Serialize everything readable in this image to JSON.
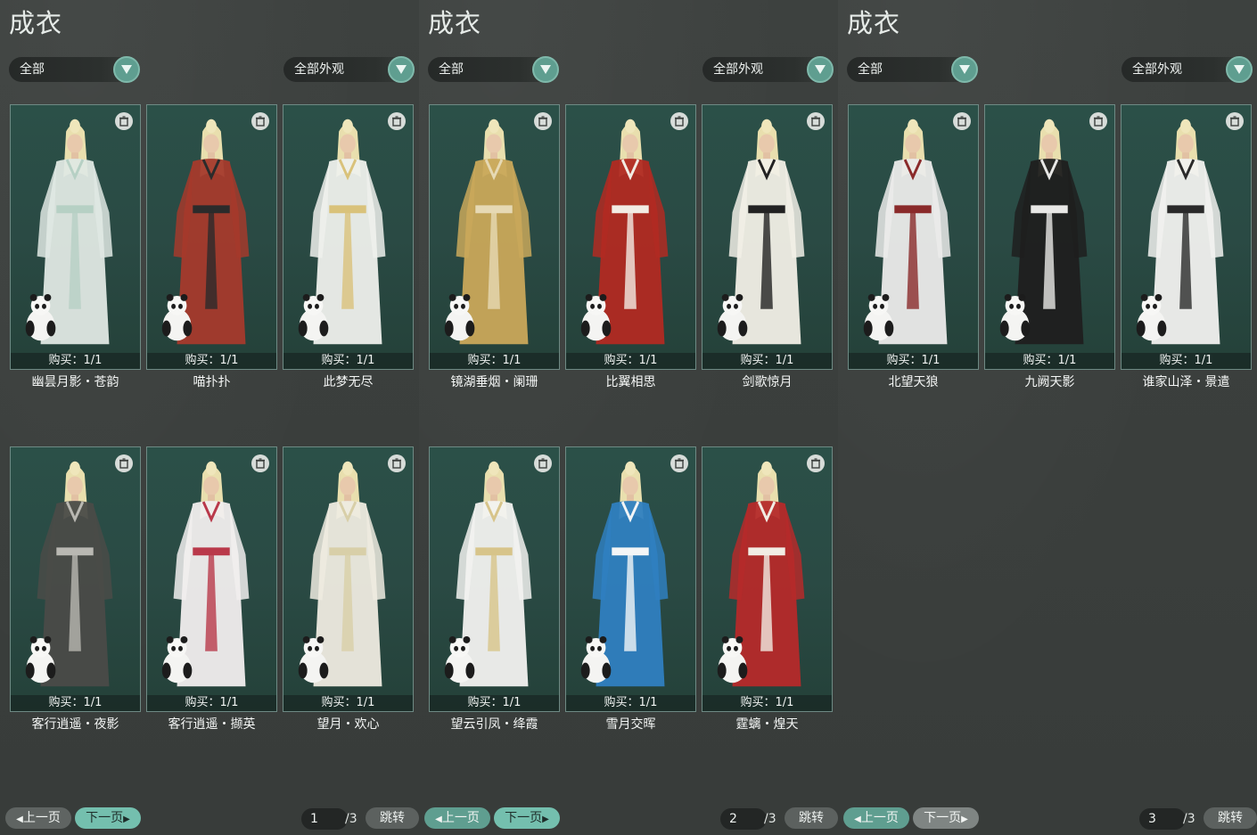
{
  "panels": [
    {
      "title": "成衣",
      "filter_left": "全部",
      "filter_right": "全部外观",
      "cards": [
        {
          "name": "幽昙月影・苍韵",
          "buy": "购买：1/1",
          "outfit_color": "#dfe8e3",
          "accent": "#b6d0c4"
        },
        {
          "name": "喵扑扑",
          "buy": "购买：1/1",
          "outfit_color": "#a53a2c",
          "accent": "#2b2b2b"
        },
        {
          "name": "此梦无尽",
          "buy": "购买：1/1",
          "outfit_color": "#eef0ec",
          "accent": "#d9c27a"
        },
        {
          "name": "客行逍遥・夜影",
          "buy": "购买：1/1",
          "outfit_color": "#4a4b48",
          "accent": "#b9b8b2"
        },
        {
          "name": "客行逍遥・撷英",
          "buy": "购买：1/1",
          "outfit_color": "#f1eeee",
          "accent": "#b9394a"
        },
        {
          "name": "望月・欢心",
          "buy": "购买：1/1",
          "outfit_color": "#eeebe0",
          "accent": "#d8cfa8"
        }
      ],
      "prev_label": "上一页",
      "next_label": "下一页",
      "page_current": "1",
      "page_total": "/3",
      "jump_label": "跳转"
    },
    {
      "title": "成衣",
      "filter_left": "全部",
      "filter_right": "全部外观",
      "cards": [
        {
          "name": "镜湖垂烟・阑珊",
          "buy": "购买：1/1",
          "outfit_color": "#c9a85a",
          "accent": "#e6d9b4"
        },
        {
          "name": "比翼相思",
          "buy": "购买：1/1",
          "outfit_color": "#b12a22",
          "accent": "#f2ece4"
        },
        {
          "name": "剑歌惊月",
          "buy": "购买：1/1",
          "outfit_color": "#f1efe6",
          "accent": "#222222"
        },
        {
          "name": "望云引凤・绛霞",
          "buy": "购买：1/1",
          "outfit_color": "#f2f2f0",
          "accent": "#d7c48a"
        },
        {
          "name": "雪月交晖",
          "buy": "购买：1/1",
          "outfit_color": "#2f7fc0",
          "accent": "#f3f5f6"
        },
        {
          "name": "霆螭・煌天",
          "buy": "购买：1/1",
          "outfit_color": "#b52a2a",
          "accent": "#f1ece4"
        }
      ],
      "prev_label": "上一页",
      "next_label": "下一页",
      "page_current": "2",
      "page_total": "/3",
      "jump_label": "跳转"
    },
    {
      "title": "成衣",
      "filter_left": "全部",
      "filter_right": "全部外观",
      "cards": [
        {
          "name": "北望天狼",
          "buy": "购买：1/1",
          "outfit_color": "#ebebea",
          "accent": "#8a2a2a"
        },
        {
          "name": "九阙天影",
          "buy": "购买：1/1",
          "outfit_color": "#1f1f1f",
          "accent": "#e8e8e6"
        },
        {
          "name": "谁家山泽・景遣",
          "buy": "购买：1/1",
          "outfit_color": "#f1f1ef",
          "accent": "#2a2a2a"
        }
      ],
      "prev_label": "上一页",
      "next_label": "下一页",
      "page_current": "3",
      "page_total": "/3",
      "jump_label": "跳转"
    }
  ]
}
